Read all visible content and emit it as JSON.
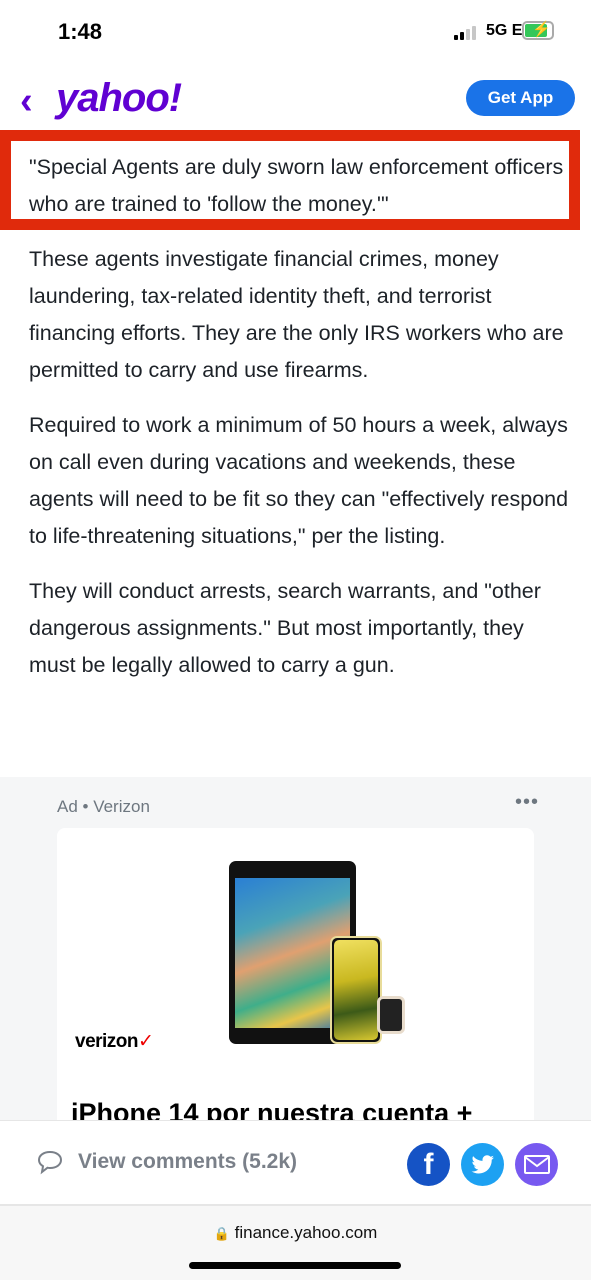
{
  "status_bar": {
    "time": "1:48",
    "network": "5G E",
    "signal_bars": 2,
    "battery_charging": true
  },
  "header": {
    "back_icon": "chevron-left-icon",
    "logo": "yahoo!",
    "get_app_label": "Get App",
    "brand_color": "#6001d2"
  },
  "highlighted_quote": "\"Special Agents are duly sworn law enforcement officers who are trained to 'follow the money.'\"",
  "highlight_color": "#e02a0c",
  "article": {
    "paragraphs": [
      "These agents investigate financial crimes, money laundering, tax-related identity theft, and terrorist financing efforts. They are the only IRS workers who are permitted to carry and use firearms.",
      "Required to work a minimum of 50 hours a week, always on call even during vacations and weekends, these agents will need to be fit so they can \"effectively respond to life-threatening situations,\" per the listing.",
      "They will conduct arrests, search warrants, and \"other dangerous assignments.\" But most importantly, they must be legally allowed to carry a gun."
    ]
  },
  "ad": {
    "label": "Ad • Verizon",
    "more_icon": "more-dots-icon",
    "brand": "verizon",
    "headline": "iPhone 14 por nuestra cuenta +"
  },
  "bottom_bar": {
    "comments_label": "View comments (5.2k)",
    "share": [
      "facebook",
      "twitter",
      "email"
    ]
  },
  "browser": {
    "url": "finance.yahoo.com"
  }
}
